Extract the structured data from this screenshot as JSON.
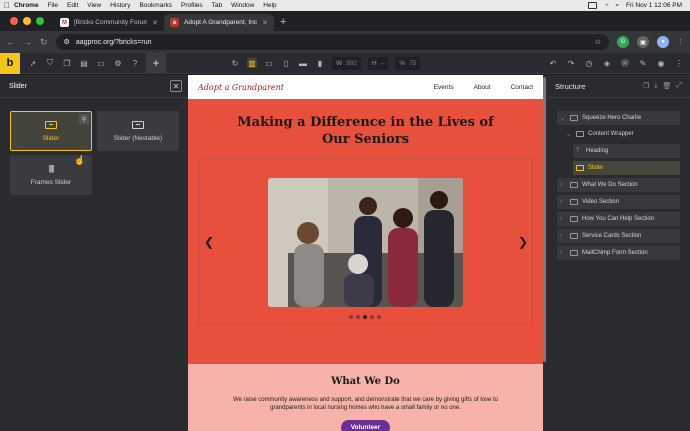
{
  "menubar": {
    "app": "Chrome",
    "items": [
      "File",
      "Edit",
      "View",
      "History",
      "Bookmarks",
      "Profiles",
      "Tab",
      "Window",
      "Help"
    ],
    "clock": "Fri Nov 1  12:06 PM"
  },
  "tabs": [
    {
      "title": "[Bricks Community Forum] [B",
      "favicon": "gmail-icon"
    },
    {
      "title": "Adopt A Grandparent, Inc. – B",
      "favicon": "site-icon"
    }
  ],
  "address": {
    "url": "aagproc.org/?bricks=run"
  },
  "toolbar": {
    "brand": "b",
    "width_label": "W",
    "width_value": "992",
    "height_label": "H",
    "height_value": "–",
    "zoom_label": "%",
    "zoom_value": "75"
  },
  "elements_panel": {
    "search_value": "Slider",
    "elements": [
      {
        "label": "Slider",
        "icon": "slider-icon",
        "selected": true
      },
      {
        "label": "Slider (Nestable)",
        "icon": "slider-icon",
        "selected": false
      },
      {
        "label": "Frames Slider",
        "icon": "barcode-icon",
        "selected": false
      }
    ]
  },
  "site": {
    "logo": "Adopt a Grandparent",
    "nav": [
      "Events",
      "About",
      "Contact"
    ],
    "hero_title_line1": "Making a Difference in the Lives of",
    "hero_title_line2": "Our Seniors",
    "slider_dots": 5,
    "slider_active_dot": 3,
    "section_title": "What We Do",
    "section_text": "We raise community awareness and support, and demonstrate that we care by giving gifts of love to grandparents in local nursing homes who have a small family or no one.",
    "cta": "Volunteer"
  },
  "structure": {
    "title": "Structure",
    "nodes": [
      {
        "label": "Squeeze Hero Charlie"
      },
      {
        "label": "Content Wrapper"
      },
      {
        "label": "Heading"
      },
      {
        "label": "Slider",
        "selected": true
      },
      {
        "label": "What We Do Section"
      },
      {
        "label": "Video Section"
      },
      {
        "label": "How You Can Help Section"
      },
      {
        "label": "Service Cards Section"
      },
      {
        "label": "MailChimp Form Section"
      }
    ]
  },
  "colors": {
    "brand_yellow": "#f5c518",
    "hero_red": "#e8503e",
    "section_pink": "#f7b3aa",
    "cta_purple": "#6b2f9a"
  }
}
